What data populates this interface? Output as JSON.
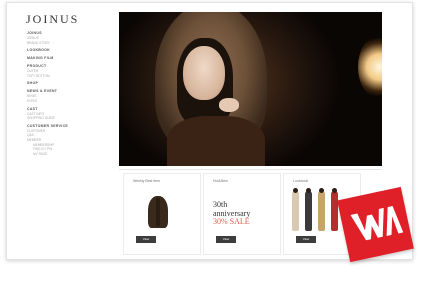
{
  "brand": {
    "logo": "JOINUS"
  },
  "sidebar": {
    "sections": [
      {
        "head": "JOINUS",
        "subs": [
          "JOINUS",
          "BRAND STORY"
        ]
      },
      {
        "head": "LOOKBOOK",
        "subs": []
      },
      {
        "head": "MAKING FILM",
        "subs": []
      },
      {
        "head": "PRODUCT",
        "subs": [
          "OUTER",
          "TOP / BOTTOM"
        ]
      },
      {
        "head": "SHOP",
        "subs": []
      },
      {
        "head": "NEWS & EVENT",
        "subs": [
          "NEWS",
          "EVENT"
        ]
      },
      {
        "head": "CAST",
        "subs": [
          "CAST INFO",
          "SHOPPING GUIDE"
        ]
      },
      {
        "head": "CUSTOMER SERVICE",
        "subs": [
          "CUSTOMER",
          "Q&A",
          "MEMBER",
          "MEMBERSHIP",
          "FIND ID / PW",
          "MY PAGE"
        ]
      }
    ]
  },
  "cards": [
    {
      "label": "Weekly Best Item",
      "button": "View"
    },
    {
      "label": "Hot&New",
      "line1": "30th",
      "line2": "anniversary",
      "line3": "30% SALE",
      "button": "View"
    },
    {
      "label": "Lookbook",
      "button": "View"
    }
  ],
  "badge": {
    "text": "WA",
    "color": "#e02028"
  }
}
